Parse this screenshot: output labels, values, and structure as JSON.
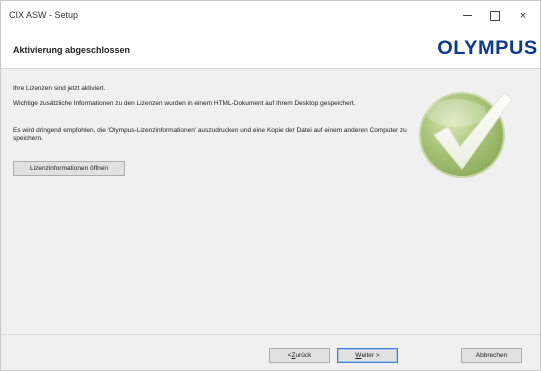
{
  "window": {
    "title": "CIX ASW - Setup",
    "minimize": "–",
    "maximize": "□",
    "close": "×"
  },
  "header": {
    "title": "Aktivierung abgeschlossen",
    "brand": "OLYMPUS",
    "brand_color": "#0d3a8c"
  },
  "content": {
    "line1": "Ihre Lizenzen sind jetzt aktiviert.",
    "line2": "Wichtige zusätzliche Informationen zu den Lizenzen wurden in einem HTML-Dokument auf Ihrem Desktop gespeichert.",
    "line3": "Es wird dringend empfohlen, die 'Olympus-Lizenzinformationen' auszudrucken und eine Kopie der Datei auf einem anderen Computer zu speichern.",
    "license_button": "Lizenzinformationen öffnen",
    "status_icon": "checkmark-icon"
  },
  "footer": {
    "back_prefix": "< ",
    "back_key": "Z",
    "back_rest": "urück",
    "next_key": "W",
    "next_rest": "eiter >",
    "cancel": "Abbrechen"
  }
}
